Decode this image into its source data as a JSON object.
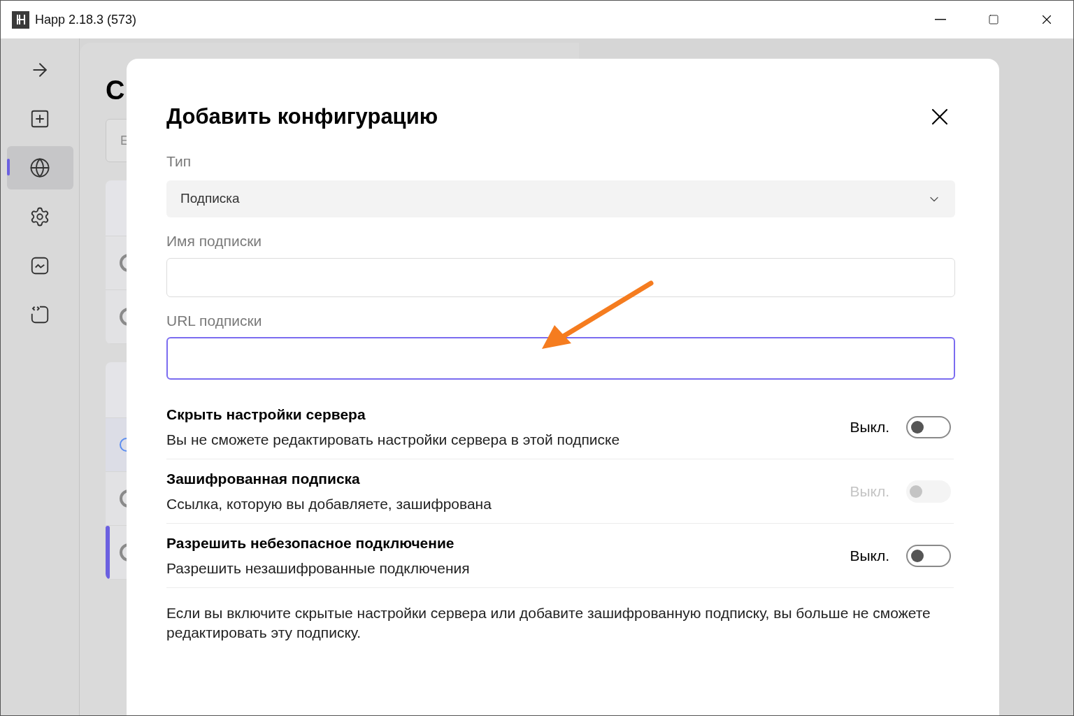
{
  "window": {
    "title": "Happ 2.18.3 (573)"
  },
  "sidebar": {
    "items": [
      {
        "kind": "arrow",
        "selected": false
      },
      {
        "kind": "add",
        "selected": false
      },
      {
        "kind": "globe",
        "selected": true
      },
      {
        "kind": "settings",
        "selected": false
      },
      {
        "kind": "chart",
        "selected": false
      },
      {
        "kind": "code",
        "selected": false
      }
    ]
  },
  "background": {
    "heading": "С",
    "search": {
      "placeholder": "Е"
    },
    "groups": [
      {
        "rows": [
          {
            "kind": "header"
          },
          {
            "kind": "server",
            "active": false
          },
          {
            "kind": "server",
            "active": false
          }
        ]
      },
      {
        "rows": [
          {
            "kind": "header"
          },
          {
            "kind": "loading",
            "active": false
          },
          {
            "kind": "server",
            "active": false
          },
          {
            "kind": "server",
            "active": true
          }
        ]
      }
    ]
  },
  "dialog": {
    "title": "Добавить конфигурацию",
    "fields": [
      {
        "kind": "select",
        "label": "Тип",
        "value": "Подписка",
        "focused": false
      },
      {
        "kind": "text",
        "label": "Имя подписки",
        "focused": false
      },
      {
        "kind": "text",
        "label": "URL подписки",
        "focused": true
      }
    ],
    "toggles": [
      {
        "title": "Скрыть настройки сервера",
        "description": "Вы не сможете редактировать настройки сервера в этой подписке",
        "state_label": "Выкл.",
        "on": false,
        "disabled": false
      },
      {
        "title": "Зашифрованная подписка",
        "description": "Ссылка, которую вы добавляете, зашифрована",
        "state_label": "Выкл.",
        "on": false,
        "disabled": true
      },
      {
        "title": "Разрешить небезопасное подключение",
        "description": "Разрешить незашифрованные подключения",
        "state_label": "Выкл.",
        "on": false,
        "disabled": false
      }
    ],
    "note": "Если вы включите скрытые настройки сервера или добавите зашифрованную подписку, вы больше не сможете редактировать эту подписку."
  }
}
